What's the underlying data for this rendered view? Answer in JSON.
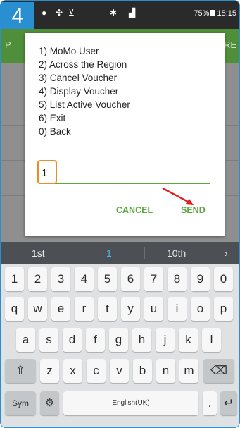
{
  "step_badge": "4",
  "status_bar": {
    "battery": "75%",
    "time": "15:15"
  },
  "app_bar": {
    "left_fragment": "P",
    "right_fragment": "RE"
  },
  "dialog": {
    "menu_items": [
      "1) MoMo User",
      "2) Across the Region",
      "3) Cancel Voucher",
      "4) Display Voucher",
      "5) List Active Voucher",
      "6) Exit",
      "0) Back"
    ],
    "input_value": "1",
    "cancel_label": "CANCEL",
    "send_label": "SEND"
  },
  "keyboard": {
    "suggestions": [
      "1st",
      "1",
      "10th"
    ],
    "rows": [
      [
        "1",
        "2",
        "3",
        "4",
        "5",
        "6",
        "7",
        "8",
        "9",
        "0"
      ],
      [
        "q",
        "w",
        "e",
        "r",
        "t",
        "y",
        "u",
        "i",
        "o",
        "p"
      ],
      [
        "a",
        "s",
        "d",
        "f",
        "g",
        "h",
        "j",
        "k",
        "l"
      ],
      [
        "z",
        "x",
        "c",
        "v",
        "b",
        "n",
        "m"
      ]
    ],
    "sym_label": "Sym",
    "space_label": "English(UK)",
    "period_label": "."
  },
  "colors": {
    "accent_green": "#5aa83e",
    "highlight_orange": "#f08a24",
    "badge_blue": "#2a8fd0",
    "arrow_red": "#e02020"
  }
}
